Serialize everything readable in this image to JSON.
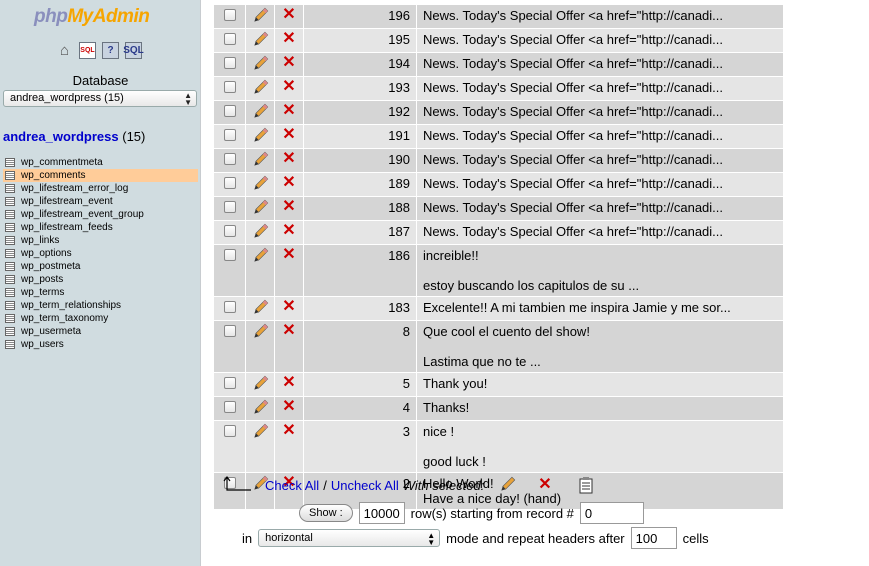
{
  "logo": {
    "part1": "php",
    "part2": "MyAdmin"
  },
  "sidebar": {
    "icons": [
      "home-icon",
      "sql-query-icon",
      "help-query-icon",
      "sql-docs-icon"
    ],
    "sql_badge": "SQL",
    "q_badge": "?",
    "db_label": "Database",
    "db_select_value": "andrea_wordpress (15)",
    "db_name": "andrea_wordpress",
    "db_count": "(15)",
    "tables": [
      {
        "name": "wp_commentmeta",
        "active": false
      },
      {
        "name": "wp_comments",
        "active": true
      },
      {
        "name": "wp_lifestream_error_log",
        "active": false
      },
      {
        "name": "wp_lifestream_event",
        "active": false
      },
      {
        "name": "wp_lifestream_event_group",
        "active": false
      },
      {
        "name": "wp_lifestream_feeds",
        "active": false
      },
      {
        "name": "wp_links",
        "active": false
      },
      {
        "name": "wp_options",
        "active": false
      },
      {
        "name": "wp_postmeta",
        "active": false
      },
      {
        "name": "wp_posts",
        "active": false
      },
      {
        "name": "wp_terms",
        "active": false
      },
      {
        "name": "wp_term_relationships",
        "active": false
      },
      {
        "name": "wp_term_taxonomy",
        "active": false
      },
      {
        "name": "wp_usermeta",
        "active": false
      },
      {
        "name": "wp_users",
        "active": false
      }
    ]
  },
  "rows": [
    {
      "id": "196",
      "lines": [
        "News. Today's Special Offer <a href=\"http://canadi..."
      ]
    },
    {
      "id": "195",
      "lines": [
        "News. Today's Special Offer <a href=\"http://canadi..."
      ]
    },
    {
      "id": "194",
      "lines": [
        "News. Today's Special Offer <a href=\"http://canadi..."
      ]
    },
    {
      "id": "193",
      "lines": [
        "News. Today's Special Offer <a href=\"http://canadi..."
      ]
    },
    {
      "id": "192",
      "lines": [
        "News. Today's Special Offer <a href=\"http://canadi..."
      ]
    },
    {
      "id": "191",
      "lines": [
        "News. Today's Special Offer <a href=\"http://canadi..."
      ]
    },
    {
      "id": "190",
      "lines": [
        "News. Today's Special Offer <a href=\"http://canadi..."
      ]
    },
    {
      "id": "189",
      "lines": [
        "News. Today's Special Offer <a href=\"http://canadi..."
      ]
    },
    {
      "id": "188",
      "lines": [
        "News. Today's Special Offer <a href=\"http://canadi..."
      ]
    },
    {
      "id": "187",
      "lines": [
        "News. Today's Special Offer <a href=\"http://canadi..."
      ]
    },
    {
      "id": "186",
      "lines": [
        "increible!!",
        "",
        "estoy buscando los capitulos de su ..."
      ]
    },
    {
      "id": "183",
      "lines": [
        "Excelente!! A mi tambien me inspira Jamie y me sor..."
      ]
    },
    {
      "id": "8",
      "lines": [
        "Que cool el cuento del show!",
        "",
        "Lastima que no te ..."
      ]
    },
    {
      "id": "5",
      "lines": [
        "Thank you!"
      ]
    },
    {
      "id": "4",
      "lines": [
        "Thanks!"
      ]
    },
    {
      "id": "3",
      "lines": [
        "nice !",
        "",
        "good luck !"
      ]
    },
    {
      "id": "2",
      "lines": [
        "Hello World!",
        "Have a nice day! (hand)"
      ]
    }
  ],
  "footer": {
    "check_all": "Check All",
    "separator": "/",
    "uncheck_all": "Uncheck All",
    "with_selected": "With selected:"
  },
  "show_controls": {
    "show_button": "Show :",
    "rows_value": "10000",
    "rows_text": "row(s) starting from record #",
    "start_value": "0",
    "in_label": "in",
    "mode_value": "horizontal",
    "mode_text": "mode and repeat headers after",
    "headers_value": "100",
    "cells_label": "cells"
  }
}
